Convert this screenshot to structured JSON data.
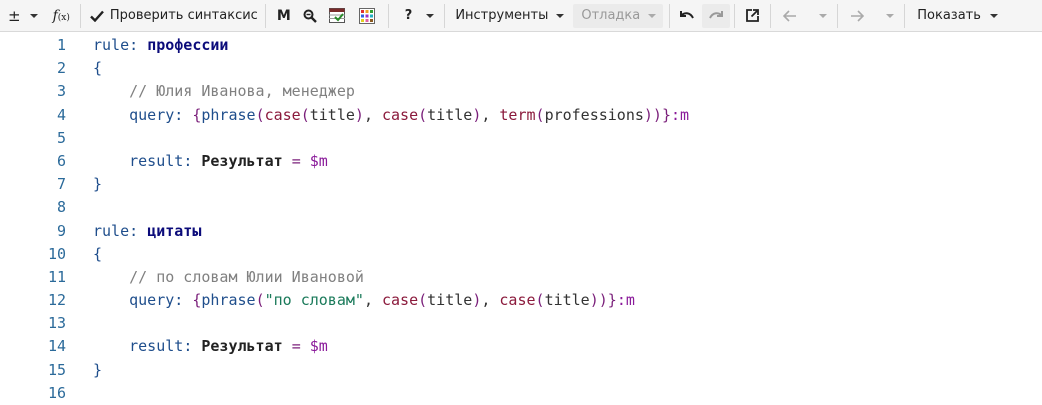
{
  "toolbar": {
    "plusminus_label": "±",
    "fx_label": "f",
    "fx_sub": "(x)",
    "check_syntax_label": "Проверить синтаксис",
    "m_label": "M",
    "help_label": "?",
    "tools_label": "Инструменты",
    "debug_label": "Отладка",
    "show_label": "Показать"
  },
  "editor": {
    "line_numbers": [
      "1",
      "2",
      "3",
      "4",
      "5",
      "6",
      "7",
      "8",
      "9",
      "10",
      "11",
      "12",
      "13",
      "14",
      "15",
      "16"
    ],
    "rule1": {
      "kw": "rule",
      "colon": ":",
      "name": "профессии",
      "open": "{",
      "comment": "// Юлия Иванова, менеджер",
      "query_kw": "query",
      "query_colon": ":",
      "brace_open": "{",
      "phrase": "phrase",
      "case1": "case",
      "arg1": "title",
      "case2": "case",
      "arg2": "title",
      "term": "term",
      "arg3": "professions",
      "brace_close": "}",
      "suffix": ":m",
      "result_kw": "result",
      "result_colon": ":",
      "result_name": "Результат",
      "eq": "=",
      "var": "$m",
      "close": "}"
    },
    "rule2": {
      "kw": "rule",
      "colon": ":",
      "name": "цитаты",
      "open": "{",
      "comment": "// по словам Юлии Ивановой",
      "query_kw": "query",
      "query_colon": ":",
      "brace_open": "{",
      "phrase": "phrase",
      "str": "\"по словам\"",
      "case1": "case",
      "arg1": "title",
      "case2": "case",
      "arg2": "title",
      "brace_close": "}",
      "suffix": ":m",
      "result_kw": "result",
      "result_colon": ":",
      "result_name": "Результат",
      "eq": "=",
      "var": "$m",
      "close": "}"
    }
  }
}
